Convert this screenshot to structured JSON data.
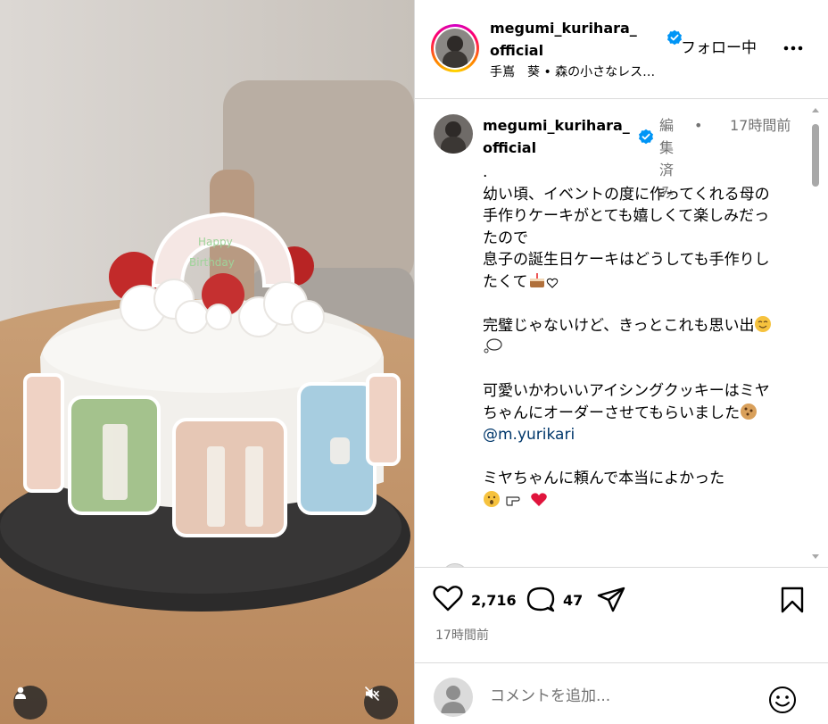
{
  "post": {
    "username": "megumi_kurihara_official",
    "follow_label": "フォロー中",
    "location": "手嶌　葵 • 森の小さなレス…"
  },
  "caption": {
    "username": "megumi_kurihara_official",
    "edited": "編集済み",
    "dot": "•",
    "time": "17時間前",
    "p0": ".",
    "p1_l1": "幼い頃、イベントの度に作ってくれる母の手作りケーキがとても嬉しくて楽しみだったので",
    "p1_l2": "息子の誕生日ケーキはどうしても手作りしたくて",
    "p2": "完璧じゃないけど、きっとこれも思い出",
    "p3": "可愛いかわいいアイシングクッキーはミヤちゃんにオーダーさせてもらいました",
    "mention": "@m.yurikari",
    "p4": "ミヤちゃんに頼んで本当によかった"
  },
  "actions": {
    "like_count": "2,716",
    "comment_count": "47",
    "post_time": "17時間前"
  },
  "comment_input": {
    "placeholder": "コメントを追加..."
  },
  "colors": {
    "verified": "#0095f6",
    "link": "#00376b",
    "muted": "#737373"
  },
  "icons": {
    "like": "heart-icon",
    "comment": "speech-bubble-icon",
    "share": "paper-plane-icon",
    "save": "bookmark-icon",
    "more": "more-horizontal-icon",
    "mute": "speaker-muted-icon",
    "tag": "user-tag-icon",
    "emoji": "smiley-icon"
  }
}
